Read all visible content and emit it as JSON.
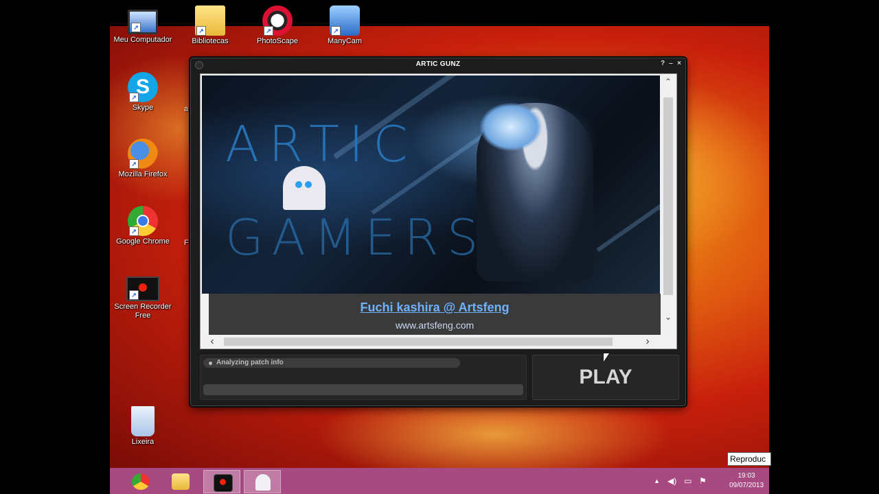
{
  "desktop": {
    "icons": [
      {
        "label": "Meu Computador",
        "icon": "computer-icon"
      },
      {
        "label": "Bibliotecas",
        "icon": "folder-icon"
      },
      {
        "label": "PhotoScape",
        "icon": "photoscape-icon"
      },
      {
        "label": "ManyCam",
        "icon": "manycam-icon"
      },
      {
        "label": "Skype",
        "icon": "skype-icon"
      },
      {
        "label": "Mozilla Firefox",
        "icon": "firefox-icon"
      },
      {
        "label": "Google Chrome",
        "icon": "chrome-icon"
      },
      {
        "label": "Screen Recorder Free",
        "icon": "screen-recorder-icon"
      },
      {
        "label": "Lixeira",
        "icon": "recycle-bin-icon"
      }
    ],
    "partial_labels": [
      "a",
      "Fc"
    ]
  },
  "launcher": {
    "title": "ARTIC GUNZ",
    "title_buttons": {
      "help": "?",
      "minimize": "–",
      "close": "×"
    },
    "banner": {
      "line1": "ARTIC",
      "line2": "GAMERS"
    },
    "caption": {
      "title": "Fuchi kashira @ Artsfeng",
      "url": "www.artsfeng.com"
    },
    "scroll": {
      "up": "⌃",
      "down": "⌄",
      "left": "‹",
      "right": "›"
    },
    "status_text": "Analyzing patch info",
    "progress": 0,
    "play_label": "PLAY"
  },
  "taskbar": {
    "items": [
      "chrome-icon",
      "folder-icon",
      "screen-recorder-icon",
      "ghost-launcher-icon"
    ],
    "active_item": "screen-recorder-icon",
    "tray_icons": [
      "up-arrow-icon",
      "volume-icon",
      "network-icon",
      "flag-icon"
    ],
    "time": "19:03",
    "date": "09/07/2013"
  },
  "tooltip": "Reproduc",
  "colors": {
    "taskbar": "#a84a82",
    "caption_link": "#6fb2ff",
    "window_bg": "#1c1c1c"
  }
}
